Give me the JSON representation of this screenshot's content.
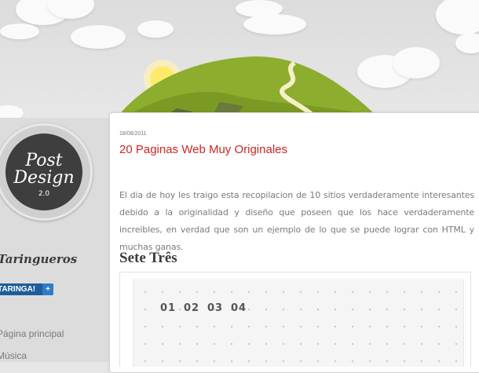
{
  "logo": {
    "line1": "Post",
    "line2": "Design",
    "version": "2.0"
  },
  "sidebar": {
    "heading": "Taringueros",
    "taringa_button": {
      "label": "TARINGA!",
      "plus": "+"
    },
    "links": [
      {
        "label": "Página principal"
      },
      {
        "label": "Música"
      }
    ]
  },
  "post": {
    "date": "18/08/2011",
    "title": "20 Paginas Web Muy Originales",
    "body": "El dia de hoy les traigo esta recopilacion de 10 sitios verdaderamente interesantes debido a la originalidad y diseño que poseen que los hace verdaderamente increibles, en verdad que son un ejemplo de lo que se puede lograr con HTML y muchas ganas."
  },
  "section": {
    "title": "Sete Três",
    "numbers": [
      "01",
      "02",
      "03",
      "04"
    ]
  },
  "colors": {
    "title_red": "#d42323",
    "taringa_blue": "#1d5e9a",
    "hill_green": "#8dad2e"
  }
}
